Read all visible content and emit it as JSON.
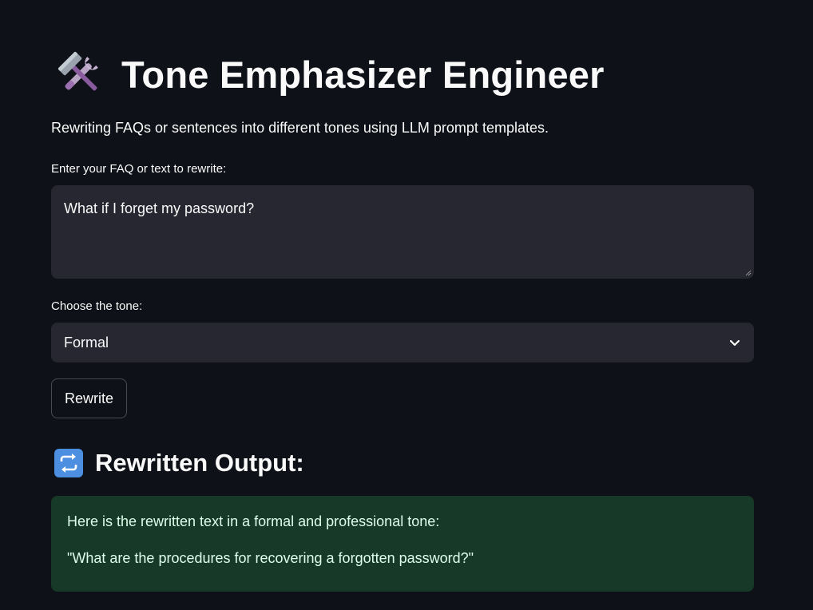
{
  "app": {
    "title": "Tone Emphasizer Engineer",
    "title_icon": "hammer-and-wrench-icon",
    "subtitle": "Rewriting FAQs or sentences into different tones using LLM prompt templates."
  },
  "form": {
    "text_label": "Enter your FAQ or text to rewrite:",
    "text_value": "What if I forget my password?",
    "tone_label": "Choose the tone:",
    "tone_selected": "Formal",
    "rewrite_button": "Rewrite"
  },
  "output": {
    "title": "Rewritten Output:",
    "title_icon": "repeat-arrows-icon",
    "lines": [
      "Here is the rewritten text in a formal and professional tone:",
      "\"What are the procedures for recovering a forgotten password?\""
    ]
  },
  "colors": {
    "background": "#0e1117",
    "input_background": "#262730",
    "success_background": "#173928",
    "success_text": "#dffde9",
    "text": "#fafafa"
  }
}
